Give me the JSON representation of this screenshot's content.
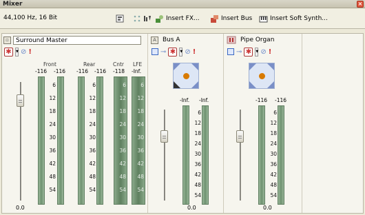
{
  "window": {
    "title": "Mixer",
    "close_label": "×"
  },
  "toolbar": {
    "format": "44,100 Hz, 16 Bit",
    "insert_fx": "Insert FX...",
    "insert_bus": "Insert Bus",
    "insert_soft_synth": "Insert Soft Synth..."
  },
  "surround": {
    "name": "Surround Master",
    "labels": {
      "front": "Front",
      "rear": "Rear",
      "cntr": "Cntr",
      "lfe": "LFE"
    },
    "peaks": [
      "-116",
      "-116",
      "-116",
      "-116",
      "-118",
      "-Inf."
    ],
    "gain": "0.0",
    "scale": [
      "6",
      "12",
      "18",
      "24",
      "30",
      "36",
      "42",
      "48",
      "54"
    ],
    "meter_scale": [
      "6",
      "12",
      "18",
      "24",
      "30",
      "36",
      "42",
      "48",
      "54"
    ]
  },
  "busA": {
    "letter": "A",
    "name": "Bus A",
    "peaks": [
      "-Inf.",
      "-Inf."
    ],
    "gain": "0.0",
    "scale": [
      "6",
      "12",
      "18",
      "24",
      "30",
      "36",
      "42",
      "48",
      "54"
    ]
  },
  "organ": {
    "name": "Pipe Organ",
    "peaks": [
      "-116",
      "-116"
    ],
    "gain": "0.0",
    "scale": [
      "6",
      "12",
      "18",
      "24",
      "30",
      "36",
      "42",
      "48",
      "54"
    ]
  }
}
